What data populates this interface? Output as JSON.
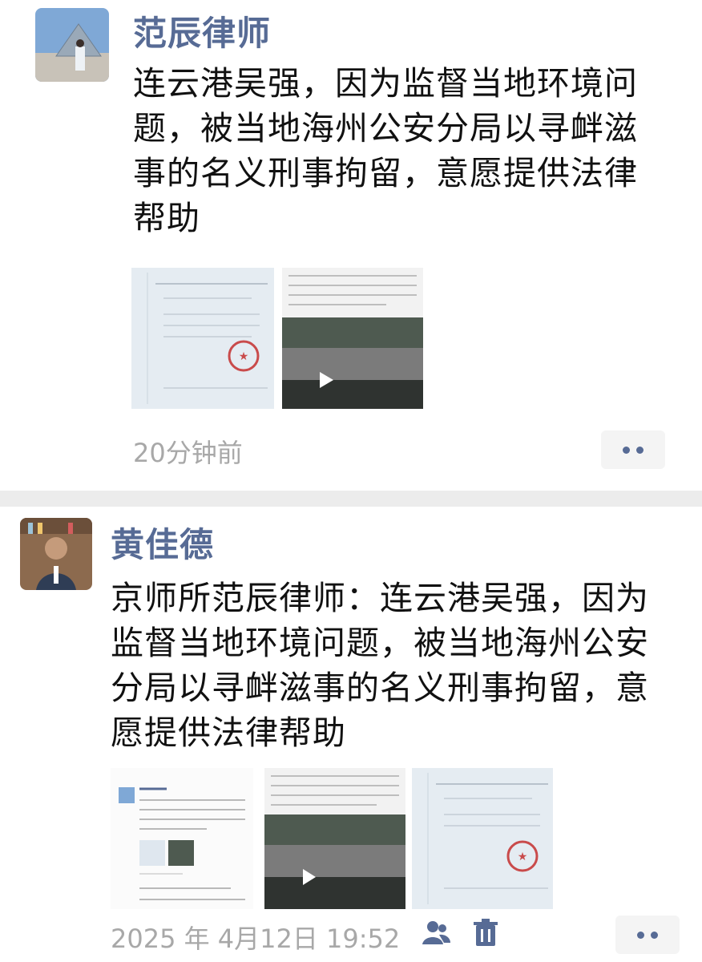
{
  "posts": [
    {
      "author": "范辰律师",
      "text_lines": [
        "连云港吴强，因为监督当地环境问",
        "题，被当地海州公安分局以寻衅滋",
        "事的名义刑事拘留，意愿提供法律",
        "帮助"
      ],
      "timestamp": "20分钟前"
    },
    {
      "author": "黄佳德",
      "text_lines": [
        "京师所范辰律师：连云港吴强，因为",
        "监督当地环境问题，被当地海州公安",
        "分局以寻衅滋事的名义刑事拘留，意",
        "愿提供法律帮助"
      ],
      "timestamp": "2025 年 4月12日 19:52"
    }
  ],
  "colors": {
    "name_blue": "#576b95",
    "separator": "#ececec",
    "timestamp": "#a8a8a8"
  },
  "icons": [
    "more-icon",
    "friends-visible-icon",
    "delete-icon",
    "play-icon"
  ]
}
